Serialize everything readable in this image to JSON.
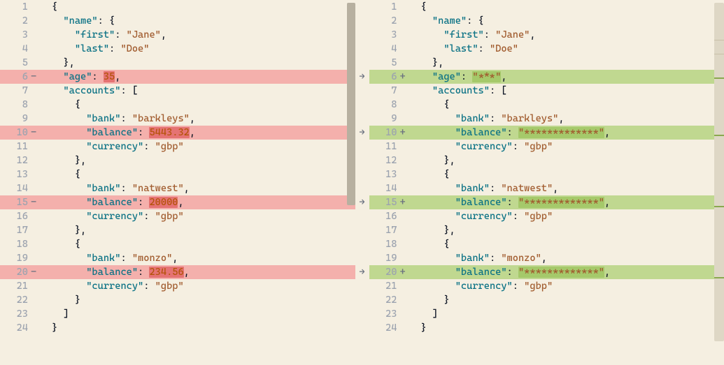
{
  "left": {
    "lines": [
      {
        "n": "1",
        "m": "",
        "html": [
          {
            "c": "p",
            "t": "{"
          }
        ],
        "d": ""
      },
      {
        "n": "2",
        "m": "",
        "html": [
          {
            "t": "  "
          },
          {
            "c": "k",
            "t": "\"name\""
          },
          {
            "c": "p",
            "t": ": {"
          }
        ],
        "d": ""
      },
      {
        "n": "3",
        "m": "",
        "html": [
          {
            "t": "    "
          },
          {
            "c": "k",
            "t": "\"first\""
          },
          {
            "c": "p",
            "t": ": "
          },
          {
            "c": "s",
            "t": "\"Jane\""
          },
          {
            "c": "p",
            "t": ","
          }
        ],
        "d": ""
      },
      {
        "n": "4",
        "m": "",
        "html": [
          {
            "t": "    "
          },
          {
            "c": "k",
            "t": "\"last\""
          },
          {
            "c": "p",
            "t": ": "
          },
          {
            "c": "s",
            "t": "\"Doe\""
          }
        ],
        "d": ""
      },
      {
        "n": "5",
        "m": "",
        "html": [
          {
            "t": "  "
          },
          {
            "c": "p",
            "t": "},"
          }
        ],
        "d": ""
      },
      {
        "n": "6",
        "m": "-",
        "html": [
          {
            "t": "  "
          },
          {
            "c": "k",
            "t": "\"age\""
          },
          {
            "c": "p",
            "t": ": "
          },
          {
            "c": "n inldel",
            "t": "35"
          },
          {
            "c": "p",
            "t": ","
          }
        ],
        "d": "rem"
      },
      {
        "n": "7",
        "m": "",
        "html": [
          {
            "t": "  "
          },
          {
            "c": "k",
            "t": "\"accounts\""
          },
          {
            "c": "p",
            "t": ": ["
          }
        ],
        "d": ""
      },
      {
        "n": "8",
        "m": "",
        "html": [
          {
            "t": "    "
          },
          {
            "c": "p",
            "t": "{"
          }
        ],
        "d": ""
      },
      {
        "n": "9",
        "m": "",
        "html": [
          {
            "t": "      "
          },
          {
            "c": "k",
            "t": "\"bank\""
          },
          {
            "c": "p",
            "t": ": "
          },
          {
            "c": "s",
            "t": "\"barkleys\""
          },
          {
            "c": "p",
            "t": ","
          }
        ],
        "d": ""
      },
      {
        "n": "10",
        "m": "-",
        "html": [
          {
            "t": "      "
          },
          {
            "c": "k",
            "t": "\"balance\""
          },
          {
            "c": "p",
            "t": ": "
          },
          {
            "c": "n inldel",
            "t": "5443.32"
          },
          {
            "c": "p",
            "t": ","
          }
        ],
        "d": "rem"
      },
      {
        "n": "11",
        "m": "",
        "html": [
          {
            "t": "      "
          },
          {
            "c": "k",
            "t": "\"currency\""
          },
          {
            "c": "p",
            "t": ": "
          },
          {
            "c": "s",
            "t": "\"gbp\""
          }
        ],
        "d": ""
      },
      {
        "n": "12",
        "m": "",
        "html": [
          {
            "t": "    "
          },
          {
            "c": "p",
            "t": "},"
          }
        ],
        "d": ""
      },
      {
        "n": "13",
        "m": "",
        "html": [
          {
            "t": "    "
          },
          {
            "c": "p",
            "t": "{"
          }
        ],
        "d": ""
      },
      {
        "n": "14",
        "m": "",
        "html": [
          {
            "t": "      "
          },
          {
            "c": "k",
            "t": "\"bank\""
          },
          {
            "c": "p",
            "t": ": "
          },
          {
            "c": "s",
            "t": "\"natwest\""
          },
          {
            "c": "p",
            "t": ","
          }
        ],
        "d": ""
      },
      {
        "n": "15",
        "m": "-",
        "html": [
          {
            "t": "      "
          },
          {
            "c": "k",
            "t": "\"balance\""
          },
          {
            "c": "p",
            "t": ": "
          },
          {
            "c": "n inldel",
            "t": "20000"
          },
          {
            "c": "p",
            "t": ","
          }
        ],
        "d": "rem"
      },
      {
        "n": "16",
        "m": "",
        "html": [
          {
            "t": "      "
          },
          {
            "c": "k",
            "t": "\"currency\""
          },
          {
            "c": "p",
            "t": ": "
          },
          {
            "c": "s",
            "t": "\"gbp\""
          }
        ],
        "d": ""
      },
      {
        "n": "17",
        "m": "",
        "html": [
          {
            "t": "    "
          },
          {
            "c": "p",
            "t": "},"
          }
        ],
        "d": ""
      },
      {
        "n": "18",
        "m": "",
        "html": [
          {
            "t": "    "
          },
          {
            "c": "p",
            "t": "{"
          }
        ],
        "d": ""
      },
      {
        "n": "19",
        "m": "",
        "html": [
          {
            "t": "      "
          },
          {
            "c": "k",
            "t": "\"bank\""
          },
          {
            "c": "p",
            "t": ": "
          },
          {
            "c": "s",
            "t": "\"monzo\""
          },
          {
            "c": "p",
            "t": ","
          }
        ],
        "d": ""
      },
      {
        "n": "20",
        "m": "-",
        "html": [
          {
            "t": "      "
          },
          {
            "c": "k",
            "t": "\"balance\""
          },
          {
            "c": "p",
            "t": ": "
          },
          {
            "c": "n inldel",
            "t": "234.56"
          },
          {
            "c": "p",
            "t": ","
          }
        ],
        "d": "rem"
      },
      {
        "n": "21",
        "m": "",
        "html": [
          {
            "t": "      "
          },
          {
            "c": "k",
            "t": "\"currency\""
          },
          {
            "c": "p",
            "t": ": "
          },
          {
            "c": "s",
            "t": "\"gbp\""
          }
        ],
        "d": ""
      },
      {
        "n": "22",
        "m": "",
        "html": [
          {
            "t": "    "
          },
          {
            "c": "p",
            "t": "}"
          }
        ],
        "d": ""
      },
      {
        "n": "23",
        "m": "",
        "html": [
          {
            "t": "  "
          },
          {
            "c": "p",
            "t": "]"
          }
        ],
        "d": ""
      },
      {
        "n": "24",
        "m": "",
        "html": [
          {
            "c": "p",
            "t": "}"
          }
        ],
        "d": ""
      }
    ]
  },
  "right": {
    "lines": [
      {
        "n": "1",
        "m": "",
        "html": [
          {
            "c": "p",
            "t": "{"
          }
        ],
        "d": ""
      },
      {
        "n": "2",
        "m": "",
        "html": [
          {
            "t": "  "
          },
          {
            "c": "k",
            "t": "\"name\""
          },
          {
            "c": "p",
            "t": ": {"
          }
        ],
        "d": ""
      },
      {
        "n": "3",
        "m": "",
        "html": [
          {
            "t": "    "
          },
          {
            "c": "k",
            "t": "\"first\""
          },
          {
            "c": "p",
            "t": ": "
          },
          {
            "c": "s",
            "t": "\"Jane\""
          },
          {
            "c": "p",
            "t": ","
          }
        ],
        "d": ""
      },
      {
        "n": "4",
        "m": "",
        "html": [
          {
            "t": "    "
          },
          {
            "c": "k",
            "t": "\"last\""
          },
          {
            "c": "p",
            "t": ": "
          },
          {
            "c": "s",
            "t": "\"Doe\""
          }
        ],
        "d": ""
      },
      {
        "n": "5",
        "m": "",
        "html": [
          {
            "t": "  "
          },
          {
            "c": "p",
            "t": "},"
          }
        ],
        "d": ""
      },
      {
        "n": "6",
        "m": "+",
        "html": [
          {
            "t": "  "
          },
          {
            "c": "k",
            "t": "\"age\""
          },
          {
            "c": "p",
            "t": ": "
          },
          {
            "c": "s inladd",
            "t": "\"***\""
          },
          {
            "c": "p",
            "t": ","
          }
        ],
        "d": "add"
      },
      {
        "n": "7",
        "m": "",
        "html": [
          {
            "t": "  "
          },
          {
            "c": "k",
            "t": "\"accounts\""
          },
          {
            "c": "p",
            "t": ": ["
          }
        ],
        "d": ""
      },
      {
        "n": "8",
        "m": "",
        "html": [
          {
            "t": "    "
          },
          {
            "c": "p",
            "t": "{"
          }
        ],
        "d": ""
      },
      {
        "n": "9",
        "m": "",
        "html": [
          {
            "t": "      "
          },
          {
            "c": "k",
            "t": "\"bank\""
          },
          {
            "c": "p",
            "t": ": "
          },
          {
            "c": "s",
            "t": "\"barkleys\""
          },
          {
            "c": "p",
            "t": ","
          }
        ],
        "d": ""
      },
      {
        "n": "10",
        "m": "+",
        "html": [
          {
            "t": "      "
          },
          {
            "c": "k",
            "t": "\"balance\""
          },
          {
            "c": "p",
            "t": ": "
          },
          {
            "c": "s inladd",
            "t": "\"*************\""
          },
          {
            "c": "p",
            "t": ","
          }
        ],
        "d": "add"
      },
      {
        "n": "11",
        "m": "",
        "html": [
          {
            "t": "      "
          },
          {
            "c": "k",
            "t": "\"currency\""
          },
          {
            "c": "p",
            "t": ": "
          },
          {
            "c": "s",
            "t": "\"gbp\""
          }
        ],
        "d": ""
      },
      {
        "n": "12",
        "m": "",
        "html": [
          {
            "t": "    "
          },
          {
            "c": "p",
            "t": "},"
          }
        ],
        "d": ""
      },
      {
        "n": "13",
        "m": "",
        "html": [
          {
            "t": "    "
          },
          {
            "c": "p",
            "t": "{"
          }
        ],
        "d": ""
      },
      {
        "n": "14",
        "m": "",
        "html": [
          {
            "t": "      "
          },
          {
            "c": "k",
            "t": "\"bank\""
          },
          {
            "c": "p",
            "t": ": "
          },
          {
            "c": "s",
            "t": "\"natwest\""
          },
          {
            "c": "p",
            "t": ","
          }
        ],
        "d": ""
      },
      {
        "n": "15",
        "m": "+",
        "html": [
          {
            "t": "      "
          },
          {
            "c": "k",
            "t": "\"balance\""
          },
          {
            "c": "p",
            "t": ": "
          },
          {
            "c": "s inladd",
            "t": "\"*************\""
          },
          {
            "c": "p",
            "t": ","
          }
        ],
        "d": "add"
      },
      {
        "n": "16",
        "m": "",
        "html": [
          {
            "t": "      "
          },
          {
            "c": "k",
            "t": "\"currency\""
          },
          {
            "c": "p",
            "t": ": "
          },
          {
            "c": "s",
            "t": "\"gbp\""
          }
        ],
        "d": ""
      },
      {
        "n": "17",
        "m": "",
        "html": [
          {
            "t": "    "
          },
          {
            "c": "p",
            "t": "},"
          }
        ],
        "d": ""
      },
      {
        "n": "18",
        "m": "",
        "html": [
          {
            "t": "    "
          },
          {
            "c": "p",
            "t": "{"
          }
        ],
        "d": ""
      },
      {
        "n": "19",
        "m": "",
        "html": [
          {
            "t": "      "
          },
          {
            "c": "k",
            "t": "\"bank\""
          },
          {
            "c": "p",
            "t": ": "
          },
          {
            "c": "s",
            "t": "\"monzo\""
          },
          {
            "c": "p",
            "t": ","
          }
        ],
        "d": ""
      },
      {
        "n": "20",
        "m": "+",
        "html": [
          {
            "t": "      "
          },
          {
            "c": "k",
            "t": "\"balance\""
          },
          {
            "c": "p",
            "t": ": "
          },
          {
            "c": "s inladd",
            "t": "\"*************\""
          },
          {
            "c": "p",
            "t": ","
          }
        ],
        "d": "add"
      },
      {
        "n": "21",
        "m": "",
        "html": [
          {
            "t": "      "
          },
          {
            "c": "k",
            "t": "\"currency\""
          },
          {
            "c": "p",
            "t": ": "
          },
          {
            "c": "s",
            "t": "\"gbp\""
          }
        ],
        "d": ""
      },
      {
        "n": "22",
        "m": "",
        "html": [
          {
            "t": "    "
          },
          {
            "c": "p",
            "t": "}"
          }
        ],
        "d": ""
      },
      {
        "n": "23",
        "m": "",
        "html": [
          {
            "t": "  "
          },
          {
            "c": "p",
            "t": "]"
          }
        ],
        "d": ""
      },
      {
        "n": "24",
        "m": "",
        "html": [
          {
            "c": "p",
            "t": "}"
          }
        ],
        "d": ""
      }
    ]
  },
  "arrows": {
    "6": "→",
    "10": "→",
    "15": "→",
    "20": "→"
  },
  "ruler_marks": [
    0.22,
    0.39,
    0.6,
    0.81
  ],
  "ruler_tlines": [
    0.11,
    0.15
  ]
}
